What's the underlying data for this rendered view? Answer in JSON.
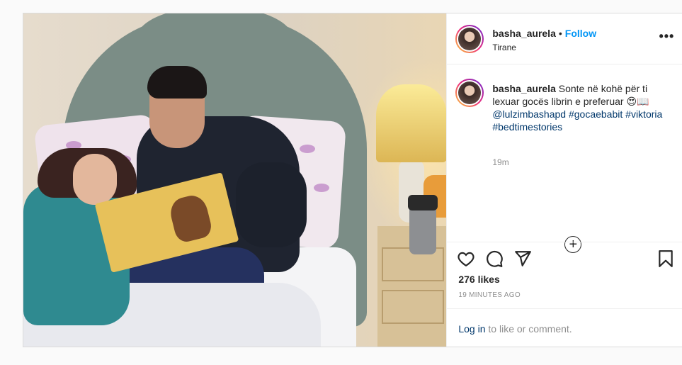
{
  "post": {
    "username": "basha_aurela",
    "follow_label": "Follow",
    "separator": "•",
    "location": "Tirane",
    "more_label": "•••",
    "photo_alt": ""
  },
  "caption": {
    "username": "basha_aurela",
    "text": "Sonte në kohë për ti lexuar gocës librin e preferuar",
    "emoji": "😍📖",
    "mentions": [
      "@lulzimbashapd",
      "#gocaebabit",
      "#viktoria",
      "#bedtimestories"
    ],
    "time": "19m",
    "load_more": "+"
  },
  "actions": {
    "like_icon": "heart-icon",
    "comment_icon": "comment-icon",
    "share_icon": "share-icon",
    "save_icon": "bookmark-icon",
    "likes_text": "276 likes",
    "time_ago": "19 MINUTES AGO"
  },
  "login": {
    "link": "Log in",
    "rest": " to like or comment."
  },
  "colors": {
    "accent": "#0095f6",
    "hashtag": "#00376b",
    "muted": "#8e8e8e"
  }
}
